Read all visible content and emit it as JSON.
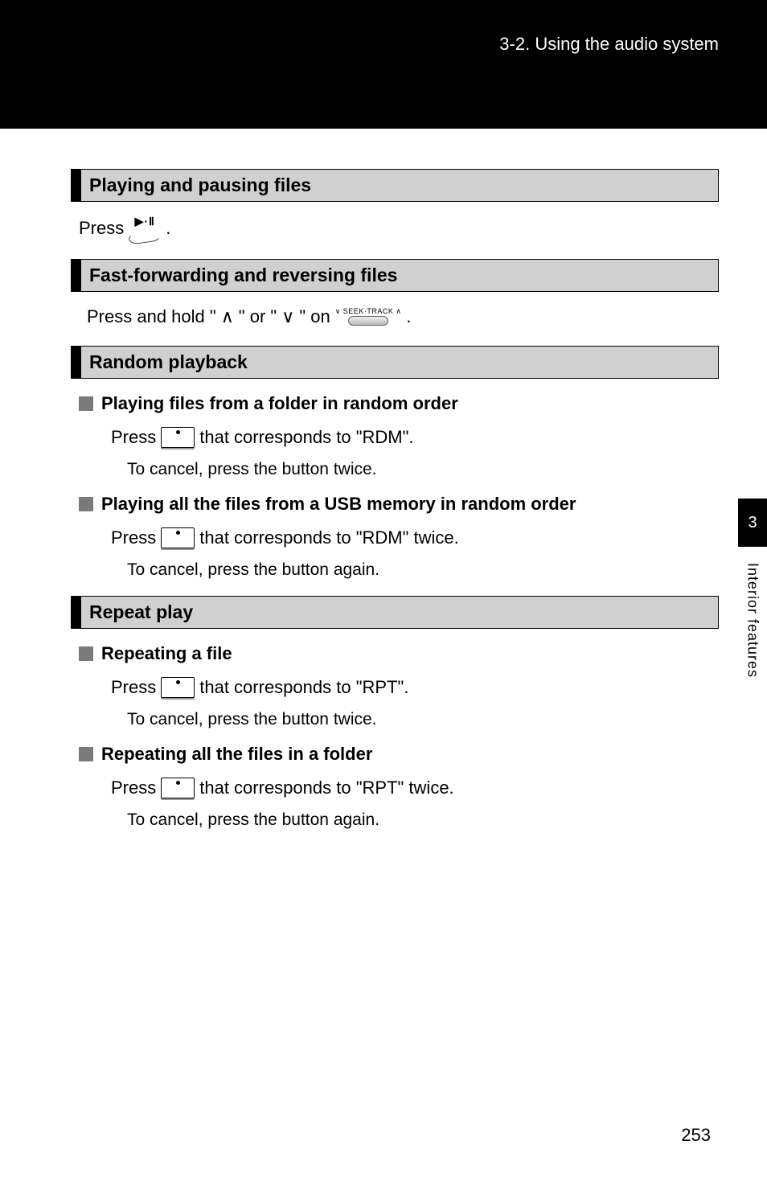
{
  "header": {
    "breadcrumb": "3-2. Using the audio system"
  },
  "sections": {
    "play_pause": {
      "title": "Playing and pausing files",
      "line_prefix": "Press ",
      "line_suffix": ".",
      "icon_name": "play-pause-icon"
    },
    "ff_rev": {
      "title": "Fast-forwarding and reversing files",
      "line_prefix": "Press and hold \"",
      "sym_up": "∧",
      "mid": "\" or \"",
      "sym_down": "∨",
      "after": "\" on ",
      "suffix": " .",
      "icon_name": "seek-track-icon"
    },
    "random": {
      "title": "Random playback",
      "sub1": {
        "heading": "Playing files from a folder in random order",
        "press": "Press ",
        "after_icon": " that corresponds to \"RDM\".",
        "cancel": "To cancel, press the button twice."
      },
      "sub2": {
        "heading": "Playing all the files from a USB memory in random order",
        "press": "Press ",
        "after_icon": " that corresponds to \"RDM\" twice.",
        "cancel": "To cancel, press the button again."
      }
    },
    "repeat": {
      "title": "Repeat play",
      "sub1": {
        "heading": "Repeating a file",
        "press": "Press ",
        "after_icon": " that corresponds to \"RPT\".",
        "cancel": "To cancel, press the button twice."
      },
      "sub2": {
        "heading": "Repeating all the files in a folder",
        "press": "Press ",
        "after_icon": " that corresponds to \"RPT\" twice.",
        "cancel": "To cancel, press the button again."
      }
    }
  },
  "side_tab": {
    "chapter": "3",
    "label": "Interior features"
  },
  "page_number": "253",
  "icons": {
    "play_pause_glyph": "▶·Ⅱ",
    "seek_label": "∨ SEEK·TRACK ∧"
  }
}
